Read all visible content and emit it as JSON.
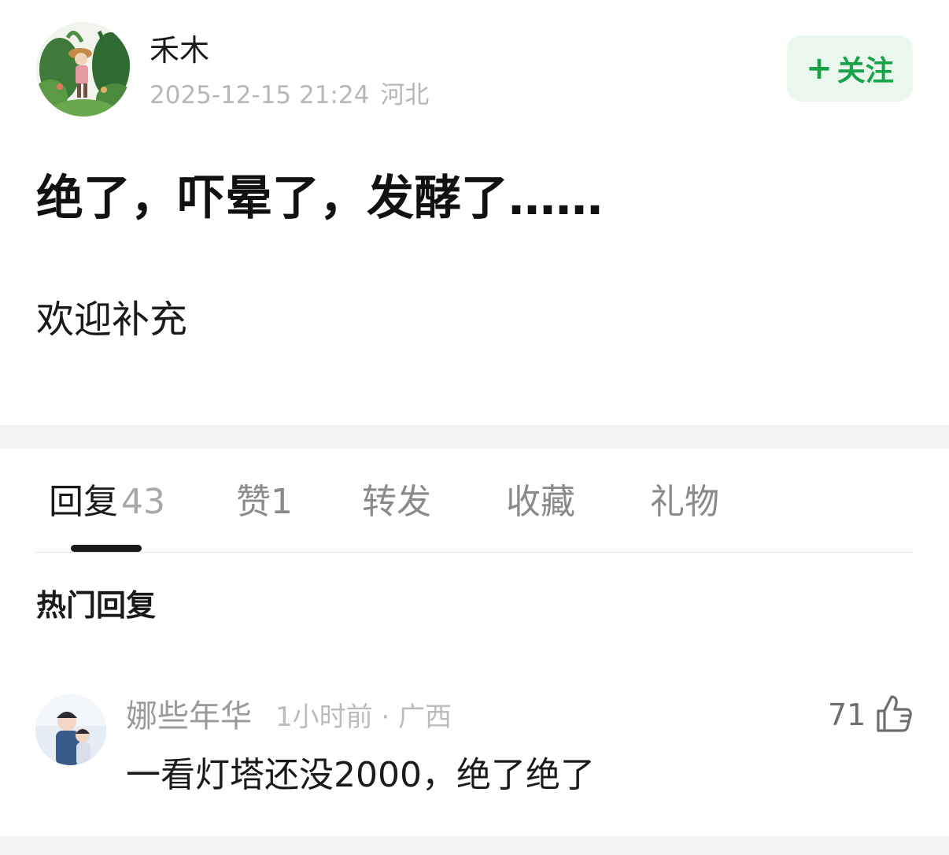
{
  "author": {
    "name": "禾木",
    "timestamp": "2025-12-15 21:24",
    "location": "河北"
  },
  "follow": {
    "plus": "+",
    "label": "关注"
  },
  "post": {
    "title": "绝了，吓晕了，发酵了……",
    "body": "欢迎补充"
  },
  "tabs": [
    {
      "label": "回复",
      "count": "43",
      "active": true
    },
    {
      "label": "赞",
      "count": "1"
    },
    {
      "label": "转发"
    },
    {
      "label": "收藏"
    },
    {
      "label": "礼物"
    }
  ],
  "section_title": "热门回复",
  "comments": [
    {
      "user": "娜些年华",
      "meta": "1小时前 · 广西",
      "likes": "71",
      "text": "一看灯塔还没2000，绝了绝了"
    }
  ],
  "icons": [
    "thumbs-up-icon"
  ],
  "colors": {
    "accent_green": "#17a34a",
    "follow_bg": "#e9f7ec"
  }
}
